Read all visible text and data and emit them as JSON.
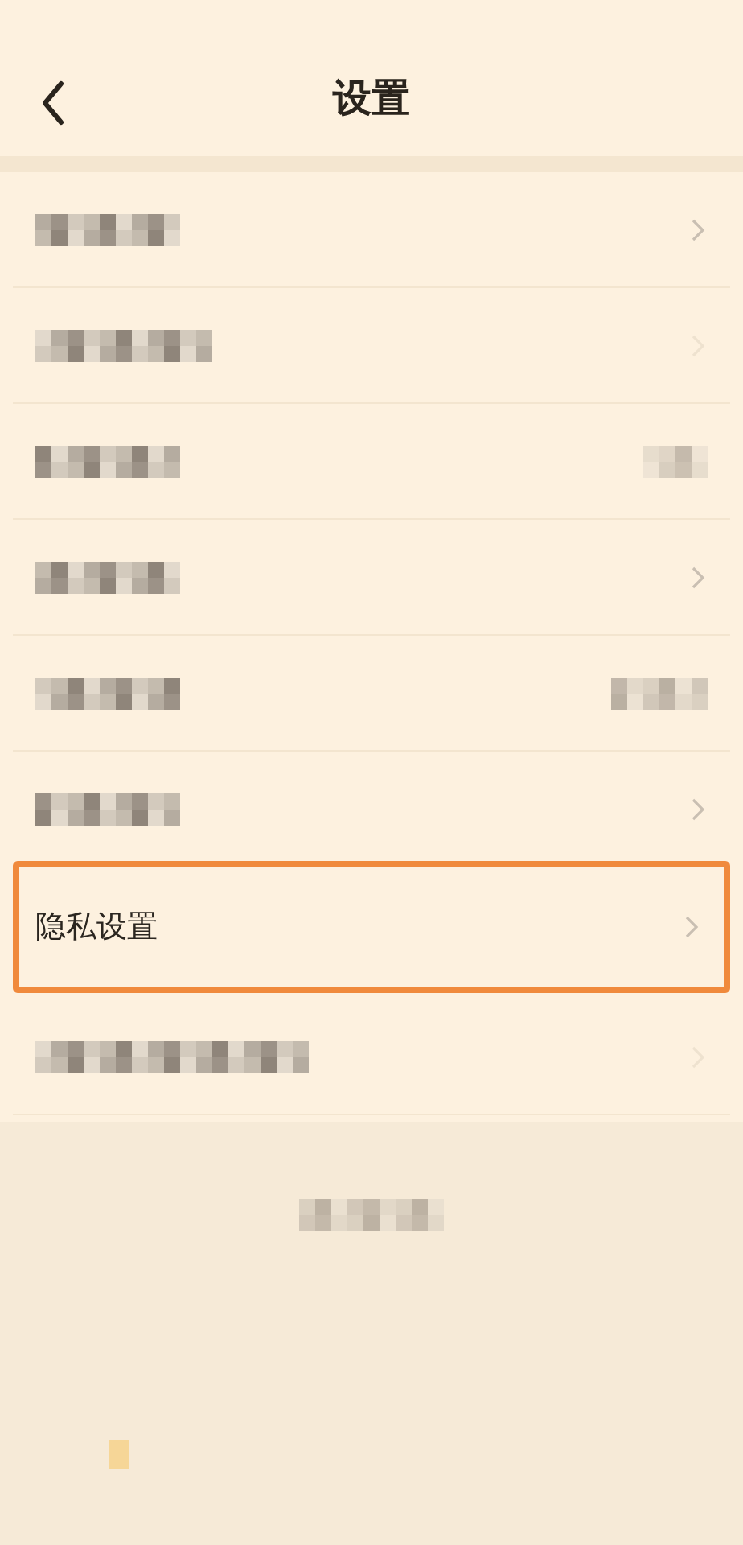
{
  "header": {
    "title": "设置"
  },
  "rows": [
    {
      "kind": "pixelated",
      "trailing": {
        "kind": "chevron"
      },
      "highlighted": false
    },
    {
      "kind": "pixelated",
      "trailing": {
        "kind": "faint"
      },
      "highlighted": false
    },
    {
      "kind": "pixelated",
      "trailing": {
        "kind": "toggle"
      },
      "highlighted": false
    },
    {
      "kind": "pixelated",
      "trailing": {
        "kind": "chevron"
      },
      "highlighted": false
    },
    {
      "kind": "pixelated",
      "trailing": {
        "kind": "value"
      },
      "highlighted": false
    },
    {
      "kind": "pixelated",
      "trailing": {
        "kind": "chevron"
      },
      "highlighted": false
    },
    {
      "kind": "text",
      "label": "隐私设置",
      "trailing": {
        "kind": "chevron"
      },
      "highlighted": true
    },
    {
      "kind": "pixelated",
      "trailing": {
        "kind": "faint"
      },
      "highlighted": false
    }
  ],
  "footer": {
    "kind": "pixelated"
  }
}
